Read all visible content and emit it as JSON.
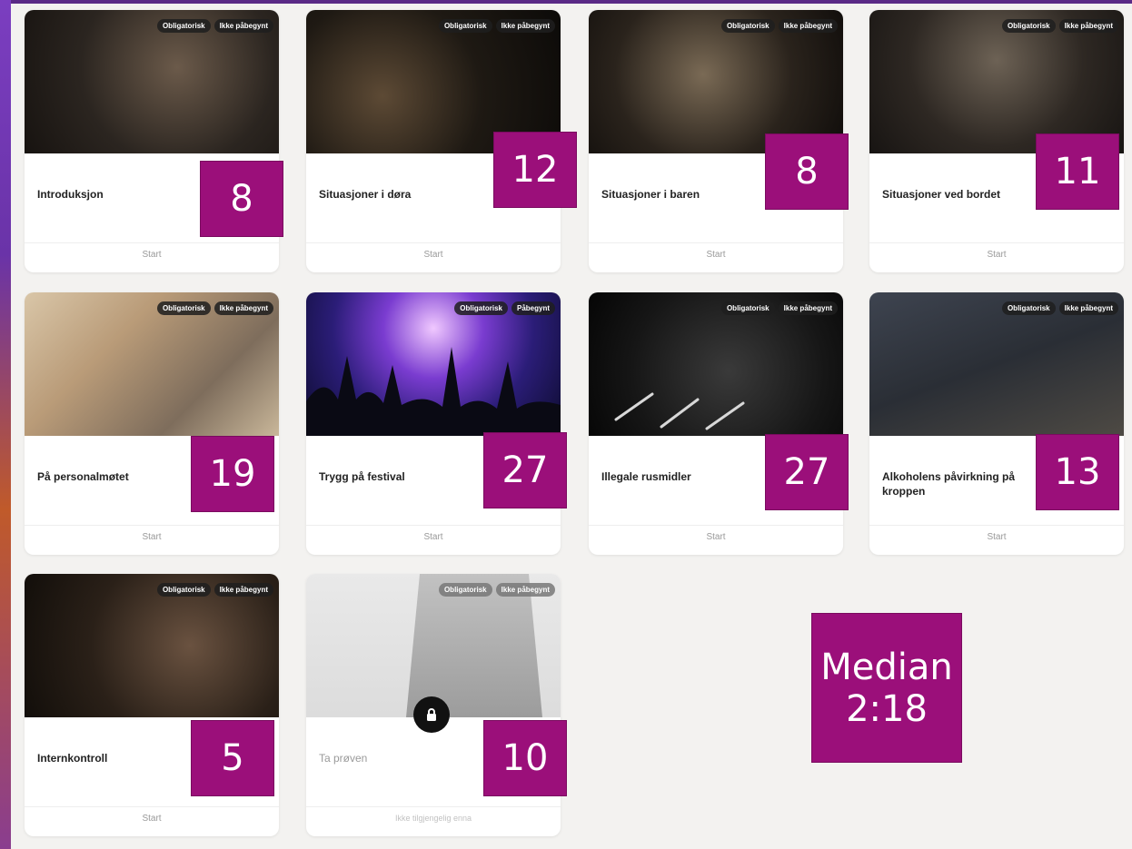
{
  "cards": [
    {
      "title": "Introduksjon",
      "tags": [
        "Obligatorisk",
        "Ikke påbegynt"
      ],
      "action": "Start",
      "count": "8"
    },
    {
      "title": "Situasjoner i døra",
      "tags": [
        "Obligatorisk",
        "Ikke påbegynt"
      ],
      "action": "Start",
      "count": "12"
    },
    {
      "title": "Situasjoner i baren",
      "tags": [
        "Obligatorisk",
        "Ikke påbegynt"
      ],
      "action": "Start",
      "count": "8"
    },
    {
      "title": "Situasjoner ved bordet",
      "tags": [
        "Obligatorisk",
        "Ikke påbegynt"
      ],
      "action": "Start",
      "count": "11"
    },
    {
      "title": "På personalmøtet",
      "tags": [
        "Obligatorisk",
        "Ikke påbegynt"
      ],
      "action": "Start",
      "count": "19"
    },
    {
      "title": "Trygg på festival",
      "tags": [
        "Obligatorisk",
        "Påbegynt"
      ],
      "action": "Start",
      "count": "27"
    },
    {
      "title": "Illegale rusmidler",
      "tags": [
        "Obligatorisk",
        "Ikke påbegynt"
      ],
      "action": "Start",
      "count": "27"
    },
    {
      "title": "Alkoholens påvirkning på kroppen",
      "tags": [
        "Obligatorisk",
        "Ikke påbegynt"
      ],
      "action": "Start",
      "count": "13"
    },
    {
      "title": "Internkontroll",
      "tags": [
        "Obligatorisk",
        "Ikke påbegynt"
      ],
      "action": "Start",
      "count": "5"
    },
    {
      "title": "Ta prøven",
      "tags": [
        "Obligatorisk",
        "Ikke påbegynt"
      ],
      "action": "Ikke tilgjengelig enna",
      "count": "10"
    }
  ],
  "median": {
    "label": "Median",
    "value": "2:18"
  },
  "icons": {
    "locked": "lock-icon"
  },
  "colors": {
    "badge": "#9b0f7a",
    "background": "#f3f2f0",
    "frame": "#4a236f"
  }
}
